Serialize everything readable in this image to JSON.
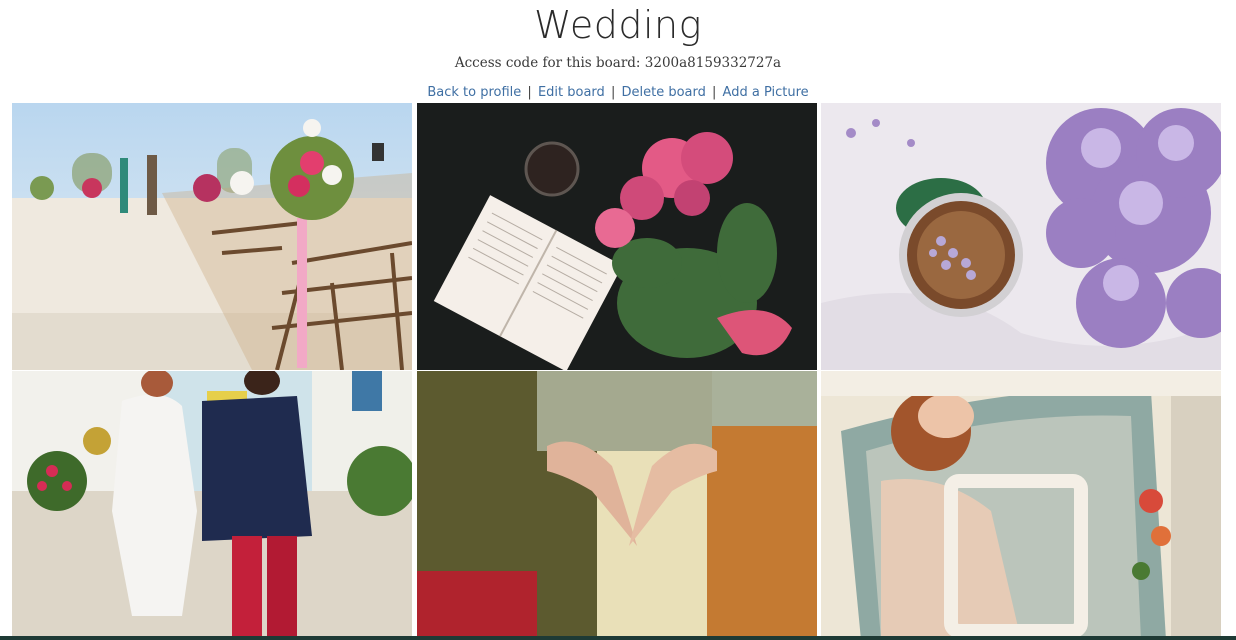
{
  "board": {
    "title": "Wedding",
    "access_prefix": "Access code for this board: ",
    "access_code": "3200a8159332727a"
  },
  "nav": {
    "back": "Back to profile",
    "sep1": "|",
    "edit": "Edit board",
    "sep2": "|",
    "delete": "Delete board",
    "sep3": "|",
    "add": "Add a Picture"
  },
  "pictures": [
    {
      "subject": "beach-ceremony-aisle-chairs-with-flowers"
    },
    {
      "subject": "open-book-and-pink-peonies-on-dark"
    },
    {
      "subject": "coffee-cup-with-lilac-flowers"
    },
    {
      "subject": "bride-and-groom-walking-away"
    },
    {
      "subject": "hands-forming-heart"
    },
    {
      "subject": "bride-in-vintage-car"
    }
  ]
}
